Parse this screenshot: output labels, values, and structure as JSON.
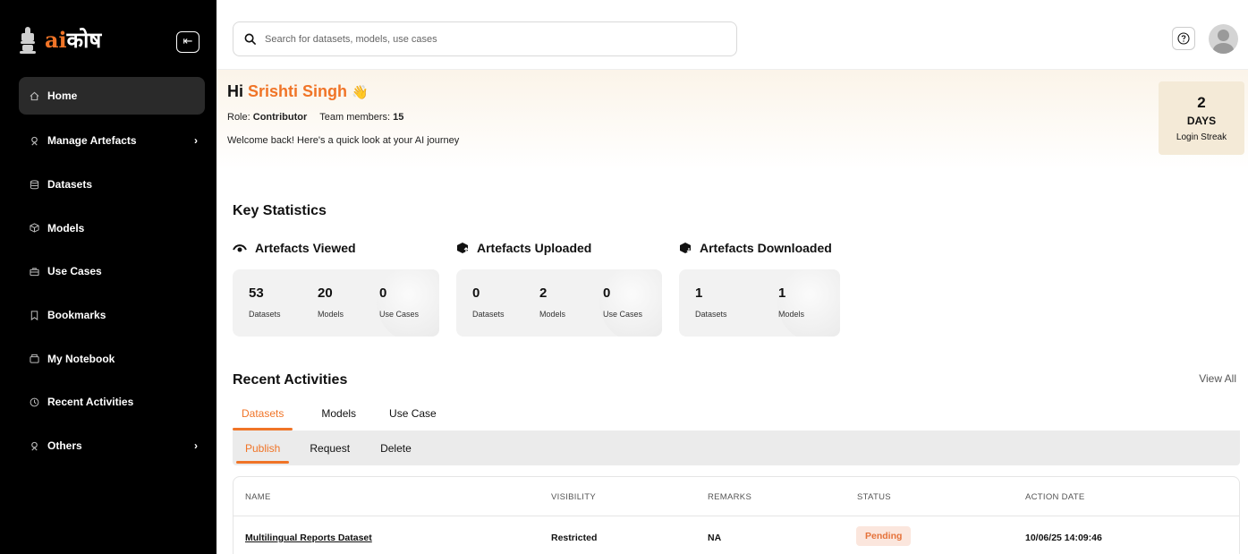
{
  "brand": {
    "prefix": "ai",
    "suffix": "कोष"
  },
  "sidebar": {
    "items": [
      {
        "label": "Home",
        "icon": "home-icon",
        "active": true
      },
      {
        "label": "Manage Artefacts",
        "icon": "manage-icon",
        "chevron": true
      },
      {
        "label": "Datasets",
        "icon": "database-icon"
      },
      {
        "label": "Models",
        "icon": "cube-icon"
      },
      {
        "label": "Use Cases",
        "icon": "briefcase-icon"
      },
      {
        "label": "Bookmarks",
        "icon": "bookmark-icon"
      },
      {
        "label": "My Notebook",
        "icon": "notebook-icon"
      },
      {
        "label": "Recent Activities",
        "icon": "clock-icon"
      },
      {
        "label": "Others",
        "icon": "others-icon",
        "chevron": true
      }
    ],
    "chevron": "›"
  },
  "search": {
    "placeholder": "Search for datasets, models, use cases"
  },
  "welcome": {
    "greeting": "Hi",
    "name": "Srishti Singh",
    "wave": "👋",
    "role_label": "Role:",
    "role_value": "Contributor",
    "team_label": "Team members:",
    "team_value": "15",
    "message": "Welcome back! Here's a quick look at your AI journey"
  },
  "streak": {
    "value": "2",
    "unit": "DAYS",
    "label": "Login Streak"
  },
  "key_stats": {
    "title": "Key Statistics",
    "viewed": {
      "title": "Artefacts Viewed",
      "stats": [
        {
          "value": "53",
          "label": "Datasets"
        },
        {
          "value": "20",
          "label": "Models"
        },
        {
          "value": "0",
          "label": "Use Cases"
        }
      ]
    },
    "uploaded": {
      "title": "Artefacts Uploaded",
      "stats": [
        {
          "value": "0",
          "label": "Datasets"
        },
        {
          "value": "2",
          "label": "Models"
        },
        {
          "value": "0",
          "label": "Use Cases"
        }
      ]
    },
    "downloaded": {
      "title": "Artefacts Downloaded",
      "stats": [
        {
          "value": "1",
          "label": "Datasets"
        },
        {
          "value": "1",
          "label": "Models"
        }
      ]
    }
  },
  "recent": {
    "title": "Recent Activities",
    "view_all": "View All",
    "tabs": [
      "Datasets",
      "Models",
      "Use Case"
    ],
    "subtabs": [
      "Publish",
      "Request",
      "Delete"
    ],
    "columns": [
      "NAME",
      "VISIBILITY",
      "REMARKS",
      "STATUS",
      "ACTION DATE"
    ],
    "rows": [
      {
        "name": "Multilingual Reports Dataset",
        "visibility": "Restricted",
        "remarks": "NA",
        "status": "Pending",
        "date": "10/06/25 14:09:46"
      }
    ]
  },
  "colors": {
    "accent": "#f07427",
    "sidebar_bg": "#000000",
    "pending_bg": "#fbe6dd"
  }
}
